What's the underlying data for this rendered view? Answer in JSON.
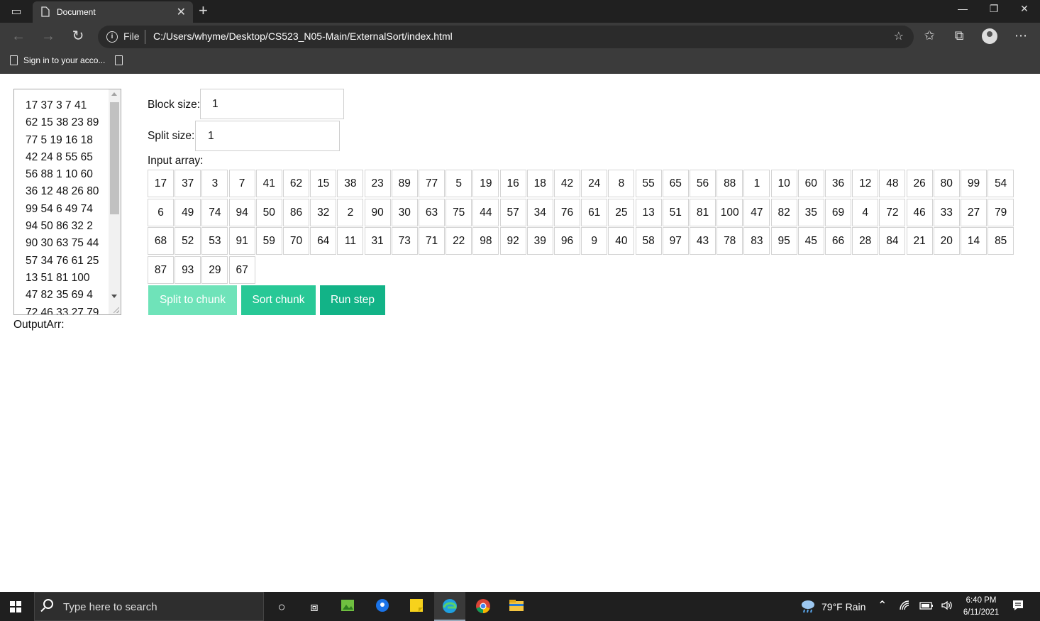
{
  "browser": {
    "tab_title": "Document",
    "address_protocol": "File",
    "url": "C:/Users/whyme/Desktop/CS523_N05-Main/ExternalSort/index.html",
    "favorite_item": "Sign in to your acco..."
  },
  "page": {
    "data_lines": [
      "17 37 3 7 41",
      "62 15 38 23 89",
      "77 5 19 16 18",
      "42 24 8 55 65",
      "56 88 1 10 60",
      "36 12 48 26 80",
      "99 54 6 49 74",
      "94 50 86 32 2",
      "90 30 63 75 44",
      "57 34 76 61 25",
      "13 51 81 100",
      "47 82 35 69 4",
      "72 46 33 27 79"
    ],
    "block_size_label": "Block size:",
    "block_size_value": "1",
    "split_size_label": "Split size:",
    "split_size_value": "1",
    "input_array_label": "Input array:",
    "input_array": [
      17,
      37,
      3,
      7,
      41,
      62,
      15,
      38,
      23,
      89,
      77,
      5,
      19,
      16,
      18,
      42,
      24,
      8,
      55,
      65,
      56,
      88,
      1,
      10,
      60,
      36,
      12,
      48,
      26,
      80,
      99,
      54,
      6,
      49,
      74,
      94,
      50,
      86,
      32,
      2,
      90,
      30,
      63,
      75,
      44,
      57,
      34,
      76,
      61,
      25,
      13,
      51,
      81,
      100,
      47,
      82,
      35,
      69,
      4,
      72,
      46,
      33,
      27,
      79,
      68,
      52,
      53,
      91,
      59,
      70,
      64,
      11,
      31,
      73,
      71,
      22,
      98,
      92,
      39,
      96,
      9,
      40,
      58,
      97,
      43,
      78,
      83,
      95,
      45,
      66,
      28,
      84,
      21,
      20,
      14,
      85,
      87,
      93,
      29,
      67
    ],
    "buttons": {
      "split": "Split to chunk",
      "sort": "Sort chunk",
      "run": "Run step"
    },
    "output_label": "OutputArr:"
  },
  "colors": {
    "split_button": "#6fe3b9",
    "sort_button": "#28c896",
    "run_button": "#12b387"
  },
  "taskbar": {
    "search_placeholder": "Type here to search",
    "weather": "79°F  Rain",
    "time": "6:40 PM",
    "date": "6/11/2021"
  }
}
